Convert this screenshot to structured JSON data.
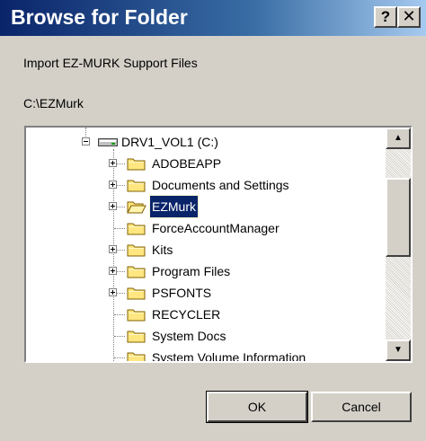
{
  "window": {
    "title": "Browse for Folder",
    "help_label": "?",
    "close_label": "✕"
  },
  "dialog": {
    "description": "Import EZ-MURK Support Files",
    "selected_path": "C:\\EZMurk"
  },
  "tree": {
    "drive": {
      "label": "DRV1_VOL1 (C:)",
      "icon": "drive-icon",
      "expanded": true
    },
    "items": [
      {
        "label": "ADOBEAPP",
        "expandable": true,
        "selected": false
      },
      {
        "label": "Documents and Settings",
        "expandable": true,
        "selected": false
      },
      {
        "label": "EZMurk",
        "expandable": true,
        "selected": true
      },
      {
        "label": "ForceAccountManager",
        "expandable": false,
        "selected": false
      },
      {
        "label": "Kits",
        "expandable": true,
        "selected": false
      },
      {
        "label": "Program Files",
        "expandable": true,
        "selected": false
      },
      {
        "label": "PSFONTS",
        "expandable": true,
        "selected": false
      },
      {
        "label": "RECYCLER",
        "expandable": false,
        "selected": false
      },
      {
        "label": "System Docs",
        "expandable": false,
        "selected": false
      },
      {
        "label": "System Volume Information",
        "expandable": false,
        "selected": false
      }
    ]
  },
  "scrollbar": {
    "up_icon": "arrow-up-icon",
    "down_icon": "arrow-down-icon"
  },
  "buttons": {
    "ok_label": "OK",
    "cancel_label": "Cancel"
  },
  "colors": {
    "titlebar": "#0a246a",
    "selection": "#0a246a",
    "folder": "#ffe680",
    "face": "#d4d0c8"
  }
}
